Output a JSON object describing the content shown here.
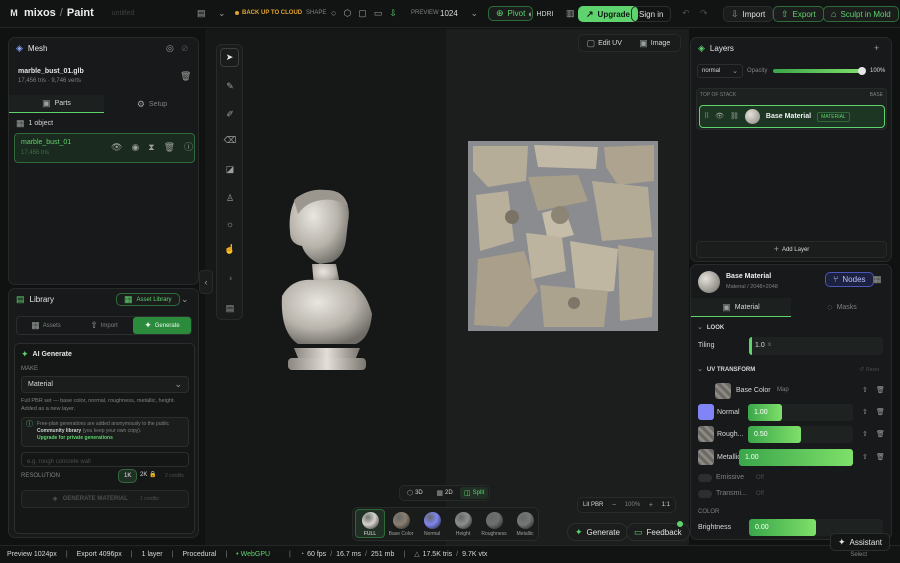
{
  "topbar": {
    "brand": "mixos",
    "app": "Paint",
    "project": "untitled",
    "backup": "BACK UP TO CLOUD",
    "shape_label": "SHAPE",
    "preview_label": "PREVIEW",
    "preview_value": "1024",
    "pivot": "Pivot",
    "hdri": "HDRI",
    "upgrade": "Upgrade",
    "signin": "Sign in",
    "import": "Import",
    "export": "Export",
    "sculpt": "Sculpt in Mold"
  },
  "mesh": {
    "title": "Mesh",
    "file": "marble_bust_01.glb",
    "stats": "17,456 tris · 9,746 verts",
    "tab_parts": "Parts",
    "tab_setup": "Setup",
    "count": "1 object",
    "item_name": "marble_bust_01",
    "item_tris": "17,456 tris"
  },
  "library": {
    "title": "Library",
    "asset_library": "Asset Library",
    "tab_assets": "Assets",
    "tab_import": "Import",
    "tab_generate": "Generate",
    "ai_title": "AI Generate",
    "make_label": "MAKE",
    "make_value": "Material",
    "desc": "Full PBR set — base color, normal, roughness, metallic, height. Added as a new layer.",
    "notice_1": "Free-plan generations are added anonymously to the public",
    "notice_bold": "Community library",
    "notice_2": "(you keep your own copy).",
    "notice_link": "Upgrade for private generations",
    "prompt_placeholder": "e.g. rough concrete wall",
    "res_label": "RESOLUTION",
    "res_1k": "1K",
    "res_2k": "2K",
    "credits": "2 credits",
    "gen_btn": "GENERATE MATERIAL",
    "gen_credits": "1 credits"
  },
  "viewport": {
    "edit_uv": "Edit UV",
    "image": "Image",
    "view_3d": "3D",
    "view_2d": "2D",
    "view_split": "Split",
    "lit": "Lit PBR",
    "zoom": "100%",
    "ratio": "1:1",
    "generate": "Generate",
    "feedback": "Feedback"
  },
  "materials": [
    {
      "label": "FULL",
      "color": "#d8d4cc"
    },
    {
      "label": "Base Color",
      "color": "#8a7f70"
    },
    {
      "label": "Normal",
      "color": "#7f86f0"
    },
    {
      "label": "Height",
      "color": "#8e8e8e"
    },
    {
      "label": "Roughness",
      "color": "#6f6f6f"
    },
    {
      "label": "Metallic",
      "color": "#777777"
    }
  ],
  "layers": {
    "title": "Layers",
    "blend": "normal",
    "opacity_label": "Opacity",
    "opacity_value": "100%",
    "opacity": 1.0,
    "top_of_stack": "TOP OF STACK",
    "base_tag": "BASE",
    "layer_name": "Base Material",
    "layer_badge": "MATERIAL",
    "add_layer": "Add Layer"
  },
  "material": {
    "name": "Base Material",
    "sub": "Material / 2048×2048",
    "nodes": "Nodes",
    "tab_material": "Material",
    "tab_masks": "Masks",
    "look": "LOOK",
    "tiling_label": "Tiling",
    "tiling_value": "1.0",
    "tiling_unit": "x",
    "uv": "UV TRANSFORM",
    "reset": "Reset",
    "base_color": "Base Color",
    "map": "Map",
    "normal_label": "Normal",
    "normal_value": "1.00",
    "normal": 1.0,
    "rough_label": "Rough...",
    "rough_value": "0.50",
    "rough": 0.5,
    "metal_label": "Metallic",
    "metal_value": "1.00",
    "metal": 1.0,
    "emissive": "Emissive",
    "emissive_val": "Off",
    "transm": "Transmi...",
    "transm_val": "Off",
    "color_section": "COLOR",
    "brightness": "Brightness",
    "brightness_value": "0.00",
    "brightness_fill": 0.5,
    "assistant": "Assistant"
  },
  "status": {
    "preview": "Preview 1024px",
    "export": "Export 4096px",
    "layers": "1 layer",
    "procedural": "Procedural",
    "webgpu": "WebGPU",
    "fps": "60 fps",
    "ms": "16.7 ms",
    "mb": "251 mb",
    "tris": "17.5K tris",
    "vtx": "9.7K vtx",
    "select": "Select"
  }
}
